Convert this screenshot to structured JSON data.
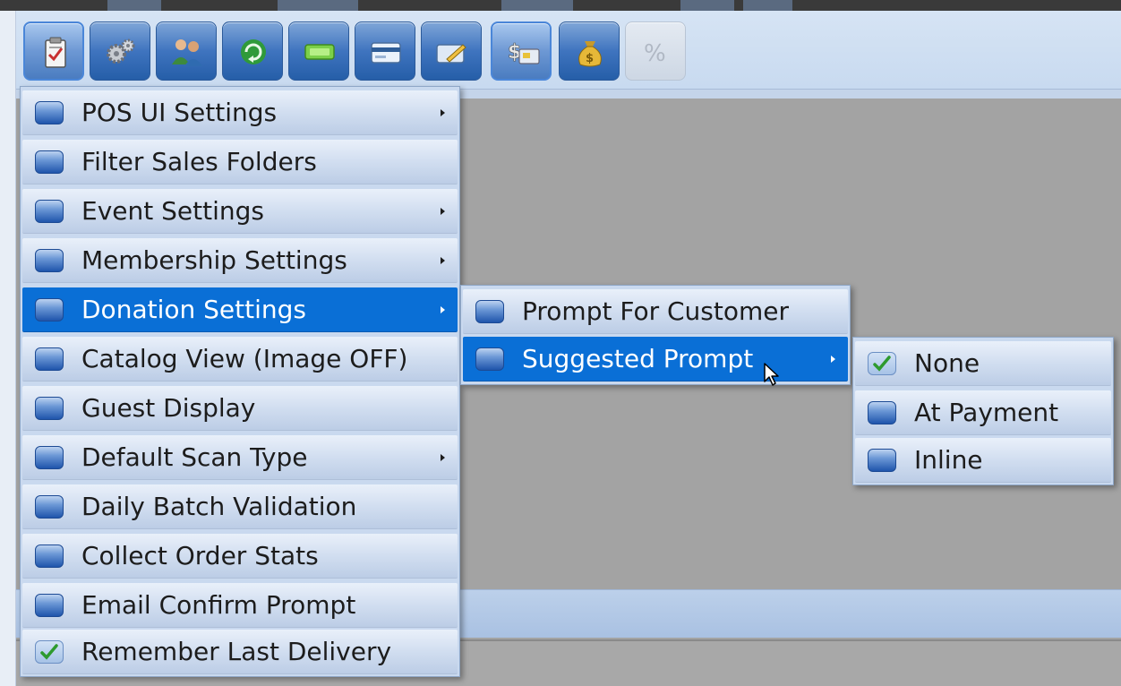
{
  "toolbar": {
    "buttons": [
      {
        "icon": "clipboard-icon",
        "active": true
      },
      {
        "icon": "gears-icon"
      },
      {
        "icon": "users-icon"
      },
      {
        "icon": "refresh-icon"
      },
      {
        "icon": "ticket-icon"
      },
      {
        "icon": "credit-card-icon"
      },
      {
        "icon": "pen-card-icon"
      },
      {
        "icon": "money-card-icon",
        "active": true
      },
      {
        "icon": "money-bag-icon"
      },
      {
        "icon": "percent-icon",
        "disabled": true,
        "label": "%"
      }
    ]
  },
  "main_menu": {
    "items": [
      {
        "label": "POS UI Settings",
        "submenu": true
      },
      {
        "label": "Filter Sales Folders",
        "submenu": false
      },
      {
        "label": "Event Settings",
        "submenu": true
      },
      {
        "label": "Membership Settings",
        "submenu": true
      },
      {
        "label": "Donation Settings",
        "submenu": true,
        "highlighted": true
      },
      {
        "label": "Catalog View (Image OFF)",
        "submenu": false
      },
      {
        "label": "Guest Display",
        "submenu": false
      },
      {
        "label": "Default Scan Type",
        "submenu": true
      },
      {
        "label": "Daily Batch Validation",
        "submenu": false
      },
      {
        "label": "Collect Order Stats",
        "submenu": false
      },
      {
        "label": "Email Confirm Prompt",
        "submenu": false
      },
      {
        "label": "Remember Last Delivery",
        "submenu": false,
        "checked": true
      }
    ]
  },
  "donation_menu": {
    "items": [
      {
        "label": "Prompt For Customer",
        "submenu": false
      },
      {
        "label": "Suggested Prompt",
        "submenu": true,
        "highlighted": true
      }
    ]
  },
  "suggested_menu": {
    "items": [
      {
        "label": "None",
        "checked": true
      },
      {
        "label": "At Payment"
      },
      {
        "label": "Inline"
      }
    ]
  },
  "colors": {
    "highlight": "#0a6fd6",
    "menu_bg": "#c9d9ef",
    "workspace": "#a3a3a3"
  }
}
